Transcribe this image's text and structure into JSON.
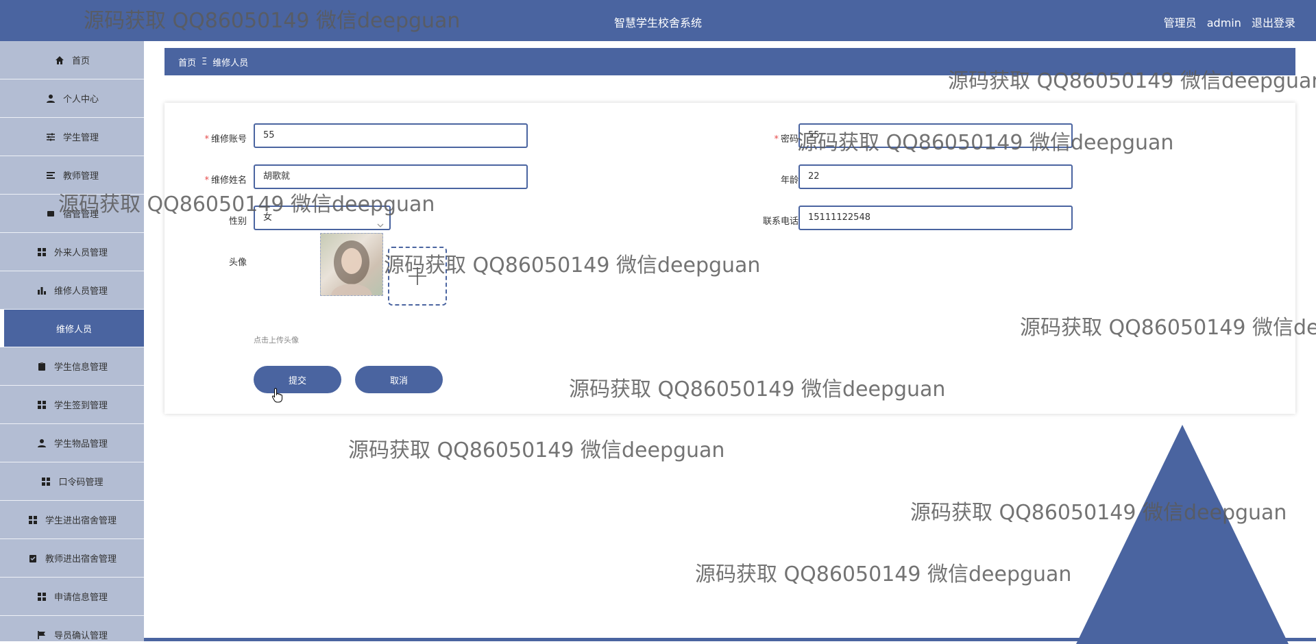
{
  "header": {
    "app_title": "智慧学生校舍系统",
    "role": "管理员",
    "username": "admin",
    "logout": "退出登录"
  },
  "sidebar": {
    "items": [
      {
        "label": "首页",
        "icon": "home-icon"
      },
      {
        "label": "个人中心",
        "icon": "user-icon"
      },
      {
        "label": "学生管理",
        "icon": "sliders-icon"
      },
      {
        "label": "教师管理",
        "icon": "list-icon"
      },
      {
        "label": "宿管管理",
        "icon": "box-icon"
      },
      {
        "label": "外来人员管理",
        "icon": "grid-icon"
      },
      {
        "label": "维修人员管理",
        "icon": "bar-chart-icon"
      },
      {
        "label": "维修人员",
        "icon": "",
        "active": true
      },
      {
        "label": "学生信息管理",
        "icon": "clipboard-icon"
      },
      {
        "label": "学生签到管理",
        "icon": "grid-icon"
      },
      {
        "label": "学生物品管理",
        "icon": "user-icon"
      },
      {
        "label": "口令码管理",
        "icon": "grid-icon"
      },
      {
        "label": "学生进出宿舍管理",
        "icon": "grid-icon"
      },
      {
        "label": "教师进出宿舍管理",
        "icon": "check-clipboard-icon"
      },
      {
        "label": "申请信息管理",
        "icon": "grid-icon"
      },
      {
        "label": "导员确认管理",
        "icon": "flag-icon"
      }
    ]
  },
  "breadcrumb": {
    "home": "首页",
    "separator": "Ξ",
    "current": "维修人员"
  },
  "form": {
    "account": {
      "label": "维修账号",
      "value": "55",
      "required": "*"
    },
    "password": {
      "label": "密码",
      "value": "55",
      "required": "*"
    },
    "name": {
      "label": "维修姓名",
      "value": "胡歌就",
      "required": "*"
    },
    "age": {
      "label": "年龄",
      "value": "22"
    },
    "gender": {
      "label": "性别",
      "value": "女"
    },
    "phone": {
      "label": "联系电话",
      "value": "15111122548"
    },
    "avatar": {
      "label": "头像",
      "hint": "点击上传头像"
    },
    "submit": "提交",
    "cancel": "取消"
  },
  "watermark": "源码获取 QQ86050149 微信deepguan",
  "colors": {
    "primary": "#4a64a0",
    "sidebar_bg": "#b3bdd3",
    "required": "#e64a4a"
  }
}
